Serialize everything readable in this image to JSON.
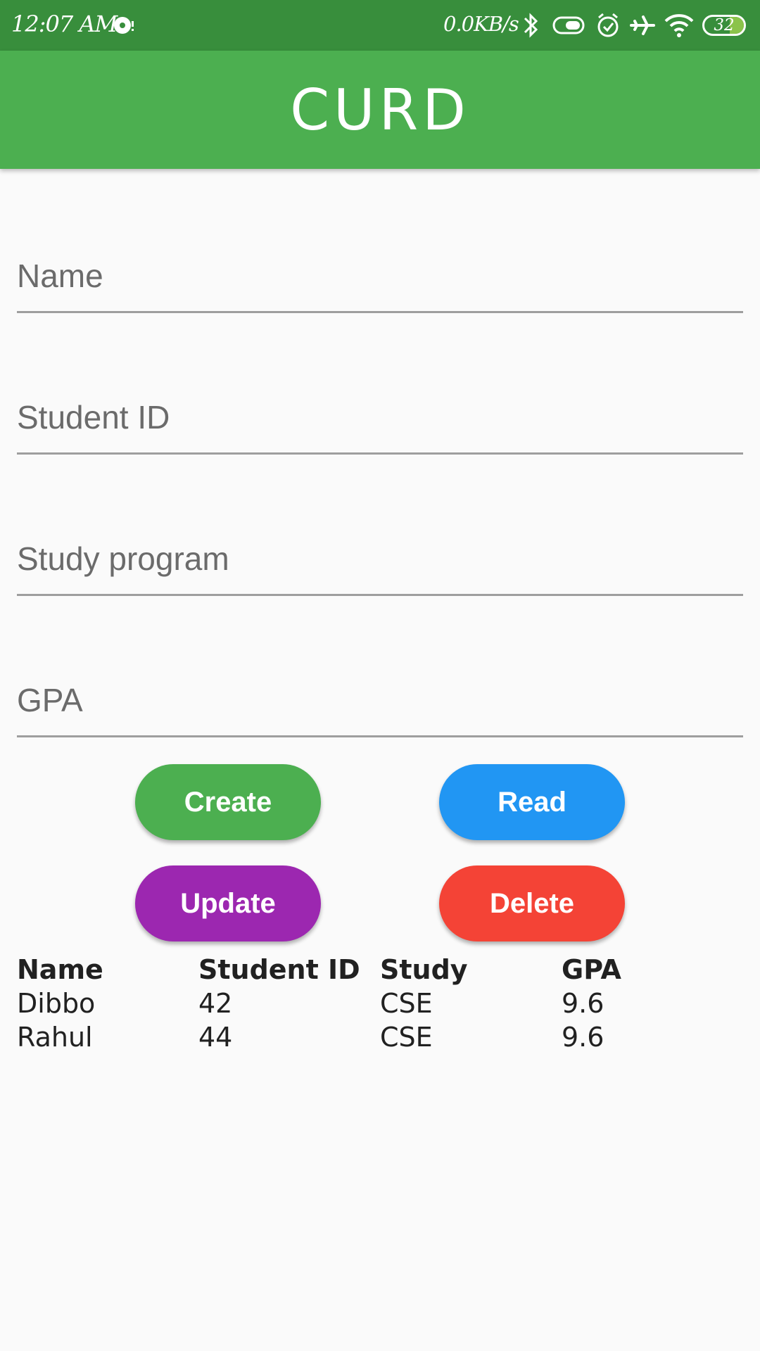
{
  "status_bar": {
    "time": "12:07 AM",
    "network_speed": "0.0KB/s",
    "battery_level": "32",
    "icons": [
      "notification-icon",
      "bluetooth-icon",
      "toggle-icon",
      "alarm-icon",
      "airplane-icon",
      "wifi-icon",
      "battery-icon"
    ]
  },
  "app_bar": {
    "title": "CURD",
    "color": "#4caf50"
  },
  "form": {
    "fields": [
      {
        "placeholder": "Name",
        "value": ""
      },
      {
        "placeholder": "Student ID",
        "value": ""
      },
      {
        "placeholder": "Study program",
        "value": ""
      },
      {
        "placeholder": "GPA",
        "value": ""
      }
    ]
  },
  "buttons": {
    "create": {
      "label": "Create",
      "color": "#4caf50"
    },
    "read": {
      "label": "Read",
      "color": "#2196f3"
    },
    "update": {
      "label": "Update",
      "color": "#9c27b0"
    },
    "delete": {
      "label": "Delete",
      "color": "#f44336"
    }
  },
  "table": {
    "headers": [
      "Name",
      "Student ID",
      "Study",
      "GPA"
    ],
    "rows": [
      [
        "Dibbo",
        "42",
        "CSE",
        "9.6"
      ],
      [
        "Rahul",
        "44",
        "CSE",
        "9.6"
      ]
    ]
  }
}
